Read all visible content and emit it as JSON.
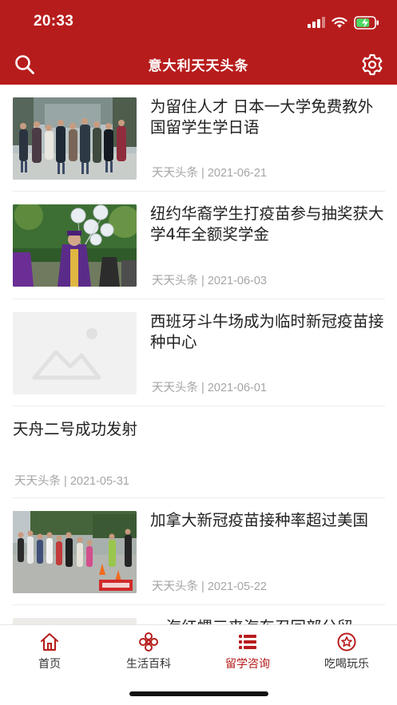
{
  "status_bar": {
    "time": "20:33"
  },
  "nav": {
    "title": "意大利天天头条"
  },
  "feed": {
    "items": [
      {
        "title": "为留住人才 日本一大学免费教外国留学生学日语",
        "source": "天天头条",
        "date": "2021-06-21",
        "meta": "天天头条 | 2021-06-21",
        "image": "students-walking-photo"
      },
      {
        "title": "纽约华裔学生打疫苗参与抽奖获大学4年全额奖学金",
        "source": "天天头条",
        "date": "2021-06-03",
        "meta": "天天头条 | 2021-06-03",
        "image": "graduate-balloons-photo"
      },
      {
        "title": "西班牙斗牛场成为临时新冠疫苗接种中心",
        "source": "天天头条",
        "date": "2021-06-01",
        "meta": "天天头条 | 2021-06-01",
        "image": "image-placeholder"
      },
      {
        "title": "天舟二号成功发射",
        "source": "天天头条",
        "date": "2021-05-31",
        "meta": "天天头条 | 2021-05-31",
        "image": null
      },
      {
        "title": "加拿大新冠疫苗接种率超过美国",
        "source": "天天头条",
        "date": "2021-05-22",
        "meta": "天天头条 | 2021-05-22",
        "image": "vaccine-queue-photo"
      },
      {
        "title": "一海红螺三来海东召回部分留",
        "image": "partial-photo"
      }
    ]
  },
  "tabs": [
    {
      "label": "首页",
      "icon": "home-icon",
      "active": false
    },
    {
      "label": "生活百科",
      "icon": "flower-icon",
      "active": false
    },
    {
      "label": "留学咨询",
      "icon": "list-icon",
      "active": true
    },
    {
      "label": "吃喝玩乐",
      "icon": "star-badge-icon",
      "active": false
    }
  ],
  "colors": {
    "brand": "#b71c1c",
    "meta_text": "#a5a5a5",
    "title_text": "#222222"
  }
}
